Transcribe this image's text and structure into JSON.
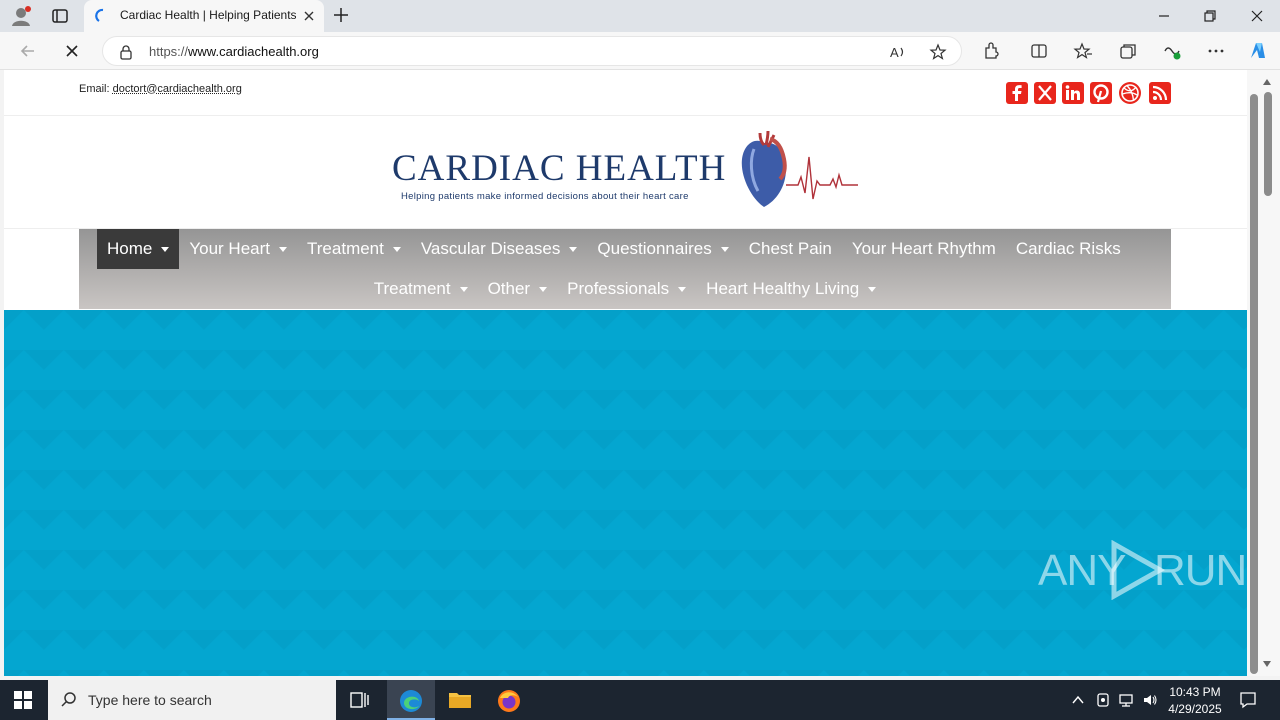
{
  "browser": {
    "tab_title": "Cardiac Health | Helping Patients",
    "url_prefix": "https://",
    "url_host": "www.cardiachealth.org"
  },
  "site": {
    "email_label": "Email:",
    "email": "doctort@cardiachealth.org",
    "logo_title": "CARDIAC HEALTH",
    "logo_subtitle": "Helping patients make informed decisions about their heart care",
    "social_icons": [
      "facebook-icon",
      "x-icon",
      "linkedin-icon",
      "pinterest-icon",
      "dribbble-icon",
      "rss-icon"
    ],
    "accent_color": "#e8261c",
    "hero_color": "#04a6d0"
  },
  "nav": {
    "row1": [
      {
        "label": "Home",
        "dropdown": true,
        "active": true
      },
      {
        "label": "Your Heart",
        "dropdown": true
      },
      {
        "label": "Treatment",
        "dropdown": true
      },
      {
        "label": "Vascular Diseases",
        "dropdown": true
      },
      {
        "label": "Questionnaires",
        "dropdown": true
      },
      {
        "label": "Chest Pain",
        "dropdown": false
      },
      {
        "label": "Your Heart Rhythm",
        "dropdown": false
      },
      {
        "label": "Cardiac Risks",
        "dropdown": false
      }
    ],
    "row2": [
      {
        "label": "Treatment",
        "dropdown": true
      },
      {
        "label": "Other",
        "dropdown": true
      },
      {
        "label": "Professionals",
        "dropdown": true
      },
      {
        "label": "Heart Healthy Living",
        "dropdown": true
      }
    ]
  },
  "watermark": {
    "left": "ANY",
    "right": "RUN"
  },
  "taskbar": {
    "search_placeholder": "Type here to search",
    "time": "10:43 PM",
    "date": "4/29/2025"
  }
}
